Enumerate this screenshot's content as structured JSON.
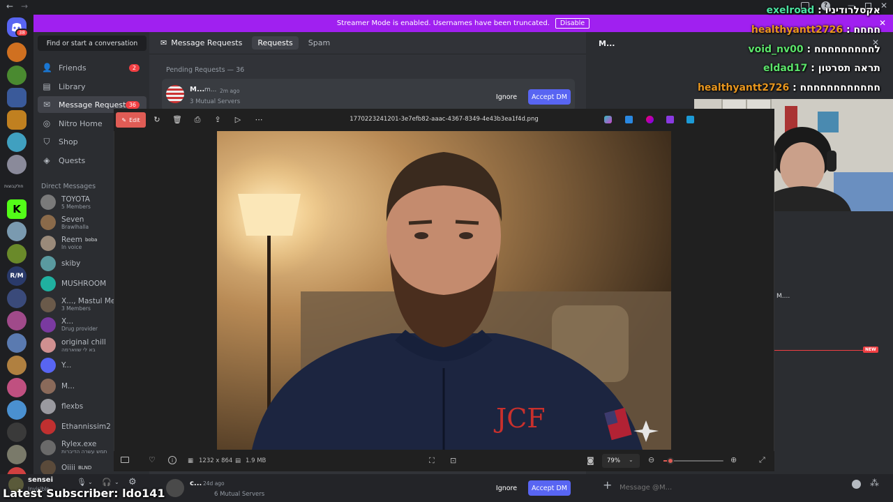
{
  "streamer_banner": {
    "text": "Streamer Mode is enabled. Usernames have been truncated.",
    "disable_label": "Disable"
  },
  "app_badge": "38",
  "server_label": "חולקבוצות",
  "dm_sidebar": {
    "search_label": "Find or start a conversation",
    "nav": [
      {
        "label": "Friends",
        "badge": "2"
      },
      {
        "label": "Library"
      },
      {
        "label": "Message Requests",
        "badge": "36"
      },
      {
        "label": "Nitro Home"
      },
      {
        "label": "Shop"
      },
      {
        "label": "Quests"
      }
    ],
    "dm_header": "Direct Messages",
    "dms": [
      {
        "name": "TOYOTA",
        "sub": "5 Members",
        "color": "#7a7a7a"
      },
      {
        "name": "Seven",
        "sub": "Brawlhalla",
        "color": "#8a6a4a"
      },
      {
        "name": "Reem",
        "tag": "boba",
        "sub": "In voice",
        "color": "#9a8a7a"
      },
      {
        "name": "skiby",
        "sub": "",
        "color": "#5a9aa0"
      },
      {
        "name": "MUSHROOM",
        "sub": "",
        "color": "#20b0a0"
      },
      {
        "name": "X..., Mastul Met",
        "sub": "3 Members",
        "color": "#6a5a4a"
      },
      {
        "name": "X...",
        "sub": "Drug provider",
        "color": "#7a3aa0"
      },
      {
        "name": "original chill",
        "sub": "בא לי שווארמה",
        "color": "#d09090"
      },
      {
        "name": "Y...",
        "sub": "",
        "color": "#5865f2"
      },
      {
        "name": "M...",
        "sub": "",
        "color": "#8a6a5a"
      },
      {
        "name": "flexbs",
        "sub": "",
        "color": "#9a9aa0"
      },
      {
        "name": "Ethannissim2 Ba",
        "sub": "",
        "color": "#c03030"
      },
      {
        "name": "Rylex.exe",
        "sub": "תמש עשרה הדיברות",
        "color": "#6a6a6a"
      },
      {
        "name": "Oiiii",
        "tag": "BLND",
        "sub": "",
        "color": "#5a4a3a"
      }
    ]
  },
  "user_panel": {
    "name": "sensei",
    "status": "Invisible"
  },
  "main": {
    "header_title": "Message Requests",
    "tabs": [
      "Requests",
      "Spam"
    ],
    "pending_label": "Pending Requests — 36",
    "request": {
      "name": "M...",
      "name2": "m...",
      "time": "2m ago",
      "mutual": "3 Mutual Servers",
      "ignore": "Ignore",
      "accept": "Accept DM"
    },
    "bottom_request": {
      "name": "c...",
      "time": "24d ago",
      "mutual": "6 Mutual Servers",
      "ignore": "Ignore",
      "accept": "Accept DM"
    }
  },
  "right_panel": {
    "header": "M...",
    "mid_label": "M....",
    "new_badge": "NEW",
    "message_placeholder": "Message @M..."
  },
  "viewer": {
    "edit_label": "Edit",
    "filename": "1770223241201-3e7efb82-aaac-4367-8349-4e43b3ea1f4d.png",
    "dimensions": "1232 x 864",
    "size": "1.9 MB",
    "zoom": "79%",
    "zoom_level": 0.12
  },
  "chat": [
    {
      "user": "exelroad",
      "message": "אקסלרודיניו",
      "color": "#4be3a0"
    },
    {
      "user": "healthyantt2726",
      "message": "חחחח",
      "color": "#e8961e"
    },
    {
      "user": "void_nv00",
      "message": "לחחחחחחחחח",
      "color": "#5be36a"
    },
    {
      "user": "eldad17",
      "message": "תראה תסרטון",
      "color": "#5be36a"
    },
    {
      "user": "healthyantt2726",
      "message": "חחחחחחחחחחחח",
      "color": "#e8961e"
    }
  ],
  "latest_subscriber": "Latest Subscriber: ldo141"
}
